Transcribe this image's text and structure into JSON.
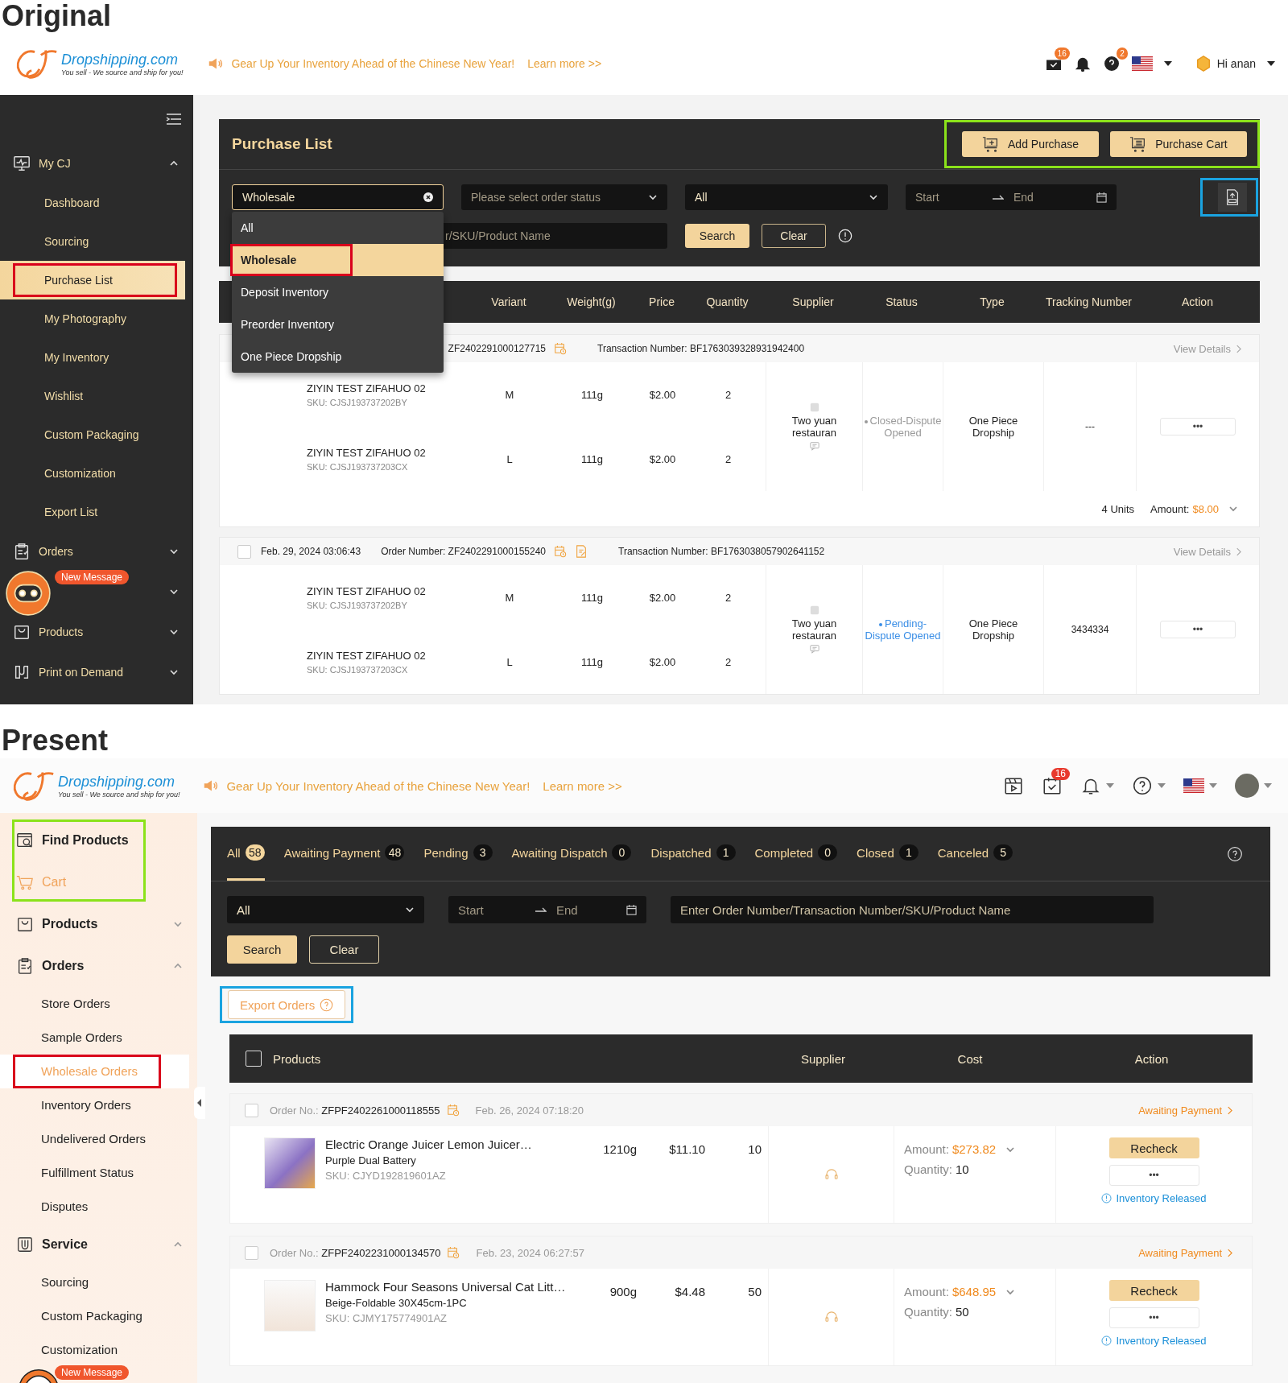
{
  "original": {
    "label": "Original",
    "header": {
      "logo": {
        "name": "Dropshipping.com",
        "tagline": "You sell - We source and ship for you!"
      },
      "announcement": "Gear Up Your Inventory Ahead of the Chinese New Year!",
      "link": "Learn more >>",
      "messages_badge": "16",
      "help_badge": "2",
      "greeting": "Hi anan"
    },
    "sidebar": {
      "items": [
        {
          "label": "My CJ",
          "expanded": true,
          "children": [
            {
              "label": "Dashboard",
              "selected": false,
              "highlighted": false
            },
            {
              "label": "Sourcing",
              "selected": false,
              "highlighted": false
            },
            {
              "label": "Purchase List",
              "selected": true,
              "highlighted": true
            },
            {
              "label": "My Photography",
              "selected": false,
              "highlighted": false
            },
            {
              "label": "My Inventory",
              "selected": false,
              "highlighted": false
            },
            {
              "label": "Wishlist",
              "selected": false,
              "highlighted": false
            },
            {
              "label": "Custom Packaging",
              "selected": false,
              "highlighted": false
            },
            {
              "label": "Customization",
              "selected": false,
              "highlighted": false
            },
            {
              "label": "Export List",
              "selected": false,
              "highlighted": false
            }
          ]
        },
        {
          "label": "Orders",
          "expanded": false
        },
        {
          "expanded": false
        },
        {
          "label": "Products",
          "expanded": false
        },
        {
          "label": "Print on Demand",
          "expanded": false
        }
      ],
      "chat_badge": "New Message"
    },
    "main": {
      "title": "Purchase List",
      "actions": [
        "Add Purchase",
        "Purchase Cart"
      ],
      "actions_highlighted": true,
      "type_select": {
        "value": "Wholesale",
        "open": true,
        "options": [
          {
            "label": "All",
            "selected": false,
            "highlighted": false
          },
          {
            "label": "Wholesale",
            "selected": true,
            "highlighted": true
          },
          {
            "label": "Deposit Inventory",
            "selected": false,
            "highlighted": false
          },
          {
            "label": "Preorder Inventory",
            "selected": false,
            "highlighted": false
          },
          {
            "label": "One Piece Dropship",
            "selected": false,
            "highlighted": false
          }
        ]
      },
      "status_select": {
        "placeholder": "Please select order status"
      },
      "category_select": {
        "value": "All"
      },
      "date_range": {
        "start": "Start",
        "end": "End"
      },
      "export_highlighted": true,
      "search": {
        "placeholder": "r/SKU/Product Name"
      },
      "buttons": [
        "Search",
        "Clear"
      ],
      "table": {
        "columns": [
          "Variant",
          "Weight(g)",
          "Price",
          "Quantity",
          "Supplier",
          "Status",
          "Type",
          "Tracking Number",
          "Action"
        ],
        "orders": [
          {
            "header": {
              "number": "ZF2402291000127715",
              "note_icon": false,
              "transaction": "Transaction Number: BF1763039328931942400",
              "link": "View Details"
            },
            "items": [
              {
                "name": "ZIYIN TEST ZIFAHUO 02",
                "sku": "SKU: CJSJ193737202BY",
                "variant": "M",
                "weight": "111g",
                "price": "$2.00",
                "quantity": "2"
              },
              {
                "name": "ZIYIN TEST ZIFAHUO 02",
                "sku": "SKU: CJSJ193737203CX",
                "variant": "L",
                "weight": "111g",
                "price": "$2.00",
                "quantity": "2"
              }
            ],
            "supplier": "Two yuan restauran",
            "status": {
              "text": "Closed-Dispute Opened",
              "color": "#9a9a9a"
            },
            "type": "One Piece Dropship",
            "tracking": "---",
            "action": "•••",
            "footer": {
              "units": "4 Units",
              "amount_label": "Amount:",
              "amount": "$8.00"
            }
          },
          {
            "header": {
              "checked": false,
              "date": "Feb. 29, 2024 03:06:43",
              "number": "Order Number: ZF2402291000155240",
              "note_icon": true,
              "transaction": "Transaction Number: BF1763038057902641152",
              "link": "View Details"
            },
            "items": [
              {
                "name": "ZIYIN TEST ZIFAHUO 02",
                "sku": "SKU: CJSJ193737202BY",
                "variant": "M",
                "weight": "111g",
                "price": "$2.00",
                "quantity": "2"
              },
              {
                "name": "ZIYIN TEST ZIFAHUO 02",
                "sku": "SKU: CJSJ193737203CX",
                "variant": "L",
                "weight": "111g",
                "price": "$2.00",
                "quantity": "2"
              }
            ],
            "supplier": "Two yuan restauran",
            "status": {
              "text": "Pending-Dispute Opened",
              "color": "#3a8ee6"
            },
            "type": "One Piece Dropship",
            "tracking": "3434334",
            "action": "•••"
          }
        ]
      }
    }
  },
  "present": {
    "label": "Present",
    "header": {
      "logo": {
        "name": "Dropshipping.com",
        "tagline": "You sell - We source and ship for you!"
      },
      "announcement": "Gear Up Your Inventory Ahead of the Chinese New Year!",
      "link": "Learn more >>",
      "tasks_badge": "16"
    },
    "sidebar": {
      "quick_highlighted": true,
      "quick_links": [
        {
          "label": "Find Products",
          "active": false
        },
        {
          "label": "Cart",
          "active": true
        }
      ],
      "items": [
        {
          "label": "Products",
          "expanded": false
        },
        {
          "label": "Orders",
          "expanded": true,
          "children": [
            {
              "label": "Store Orders",
              "selected": false,
              "highlighted": false
            },
            {
              "label": "Sample Orders",
              "selected": false,
              "highlighted": false
            },
            {
              "label": "Wholesale Orders",
              "selected": true,
              "highlighted": true
            },
            {
              "label": "Inventory Orders",
              "selected": false,
              "highlighted": false
            },
            {
              "label": "Undelivered Orders",
              "selected": false,
              "highlighted": false
            },
            {
              "label": "Fulfillment Status",
              "selected": false,
              "highlighted": false
            },
            {
              "label": "Disputes",
              "selected": false,
              "highlighted": false
            }
          ]
        },
        {
          "label": "Service",
          "expanded": true,
          "children": [
            {
              "label": "Sourcing",
              "selected": false,
              "highlighted": false
            },
            {
              "label": "Custom Packaging",
              "selected": false,
              "highlighted": false
            },
            {
              "label": "Customization",
              "selected": false,
              "highlighted": false
            }
          ]
        }
      ],
      "chat_badge": "New Message"
    },
    "main": {
      "tabs": [
        {
          "label": "All",
          "count": "58",
          "selected": true
        },
        {
          "label": "Awaiting Payment",
          "count": "48",
          "selected": false
        },
        {
          "label": "Pending",
          "count": "3",
          "selected": false
        },
        {
          "label": "Awaiting Dispatch",
          "count": "0",
          "selected": false
        },
        {
          "label": "Dispatched",
          "count": "1",
          "selected": false
        },
        {
          "label": "Completed",
          "count": "0",
          "selected": false
        },
        {
          "label": "Closed",
          "count": "1",
          "selected": false
        },
        {
          "label": "Canceled",
          "count": "5",
          "selected": false
        }
      ],
      "filter_select": {
        "value": "All"
      },
      "date_range": {
        "start": "Start",
        "end": "End"
      },
      "search": {
        "placeholder": "Enter Order Number/Transaction Number/SKU/Product Name"
      },
      "buttons": [
        "Search",
        "Clear"
      ],
      "export": {
        "label": "Export Orders",
        "highlighted": true
      },
      "table": {
        "checked": false,
        "columns": [
          "Products",
          "Supplier",
          "Cost",
          "Action"
        ],
        "orders": [
          {
            "checked": false,
            "number": "Order No.: **ZFPF2402261000118555**",
            "date": "Feb. 26, 2024 07:18:20",
            "status": "Awaiting Payment",
            "product": {
              "name": "Electric Orange Juicer Lemon Juicer…",
              "variant": "Purple Dual Battery",
              "sku": "SKU: CJYD192819601AZ",
              "weight": "1210g",
              "price": "$11.10",
              "quantity": "10"
            },
            "amount_label": "Amount:",
            "amount": "$273.82",
            "quantity_label": "Quantity:",
            "quantity": "10",
            "actions": [
              "Recheck",
              "•••"
            ],
            "notice": "Inventory Released"
          },
          {
            "checked": false,
            "number": "Order No.: **ZFPF2402231000134570**",
            "date": "Feb. 23, 2024 06:27:57",
            "status": "Awaiting Payment",
            "product": {
              "name": "Hammock Four Seasons Universal Cat Litt…",
              "variant": "Beige-Foldable 30X45cm-1PC",
              "sku": "SKU: CJMY175774901AZ",
              "weight": "900g",
              "price": "$4.48",
              "quantity": "50"
            },
            "amount_label": "Amount:",
            "amount": "$648.95",
            "quantity_label": "Quantity:",
            "quantity": "50",
            "actions": [
              "Recheck",
              "•••"
            ],
            "notice": "Inventory Released"
          }
        ]
      }
    }
  }
}
